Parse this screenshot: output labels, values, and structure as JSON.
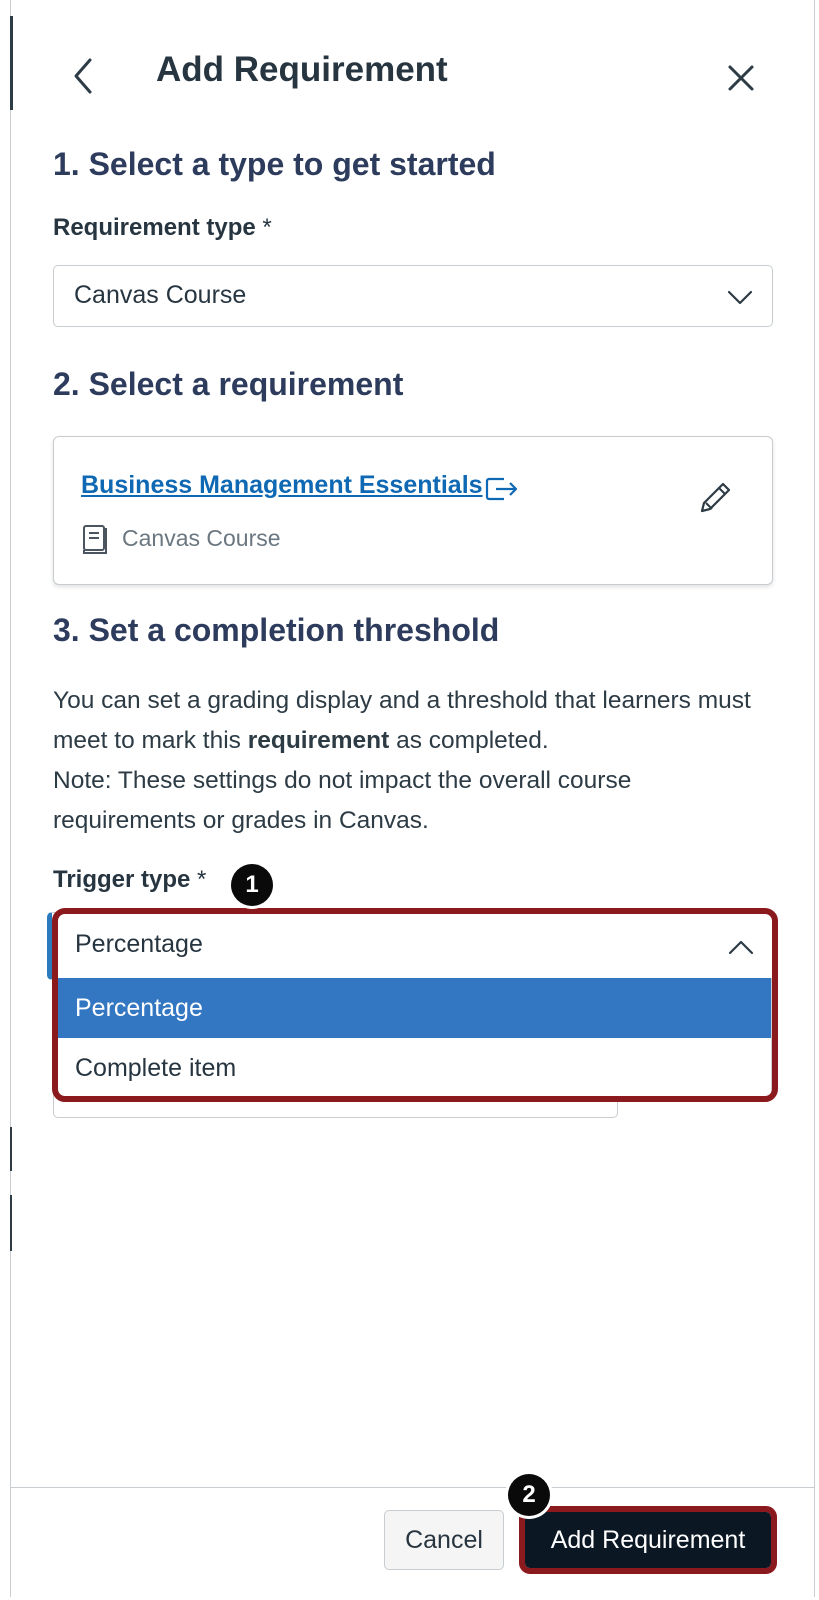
{
  "dialog": {
    "title": "Add Requirement"
  },
  "step1": {
    "heading": "1. Select a type to get started",
    "field_label": "Requirement type",
    "required_mark": "*",
    "selected_value": "Canvas Course"
  },
  "step2": {
    "heading": "2. Select a requirement",
    "requirement_link": "Business Management Essentials",
    "requirement_type": "Canvas Course"
  },
  "step3": {
    "heading": "3. Set a completion threshold",
    "description_part1": "You can set a grading display and a threshold that learners must meet to mark this ",
    "description_bold": "requirement",
    "description_part2": " as completed.",
    "note": "Note: These settings do not impact the overall course requirements or grades in Canvas.",
    "field_label": "Trigger type",
    "required_mark": "*",
    "selected_value": "Percentage",
    "options": [
      "Percentage",
      "Complete item"
    ]
  },
  "callouts": {
    "badge1": "1",
    "badge2": "2"
  },
  "footer": {
    "cancel_label": "Cancel",
    "add_label": "Add Requirement"
  },
  "icons": {
    "back": "chevron-left-icon",
    "close": "close-icon",
    "external": "external-link-icon",
    "course": "book-icon",
    "edit": "pencil-icon",
    "select_collapsed": "chevron-down-icon",
    "select_expanded": "chevron-up-icon"
  },
  "colors": {
    "link": "#0e68b3",
    "selected_option": "#3377c2",
    "primary_button": "#0b1824",
    "callout": "#8b1a1f",
    "focus_border": "#2b7abc"
  }
}
